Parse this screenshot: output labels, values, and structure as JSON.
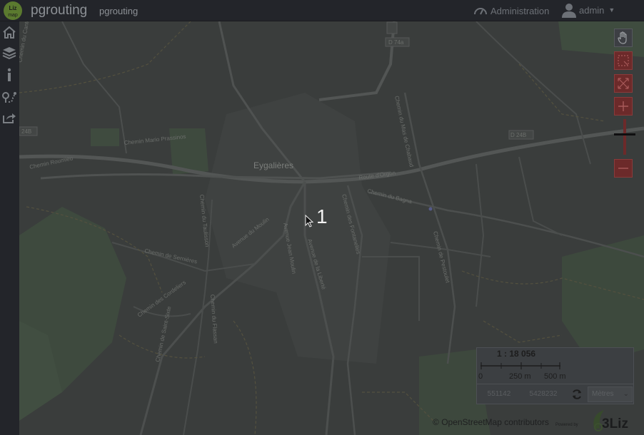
{
  "header": {
    "logo_text": "Liz map",
    "app_title": "pgrouting",
    "project_title": "pgrouting",
    "admin_label": "Administration",
    "user_label": "admin"
  },
  "leftbar": {
    "items": [
      {
        "icon": "home-icon"
      },
      {
        "icon": "layers-icon"
      },
      {
        "icon": "info-icon"
      },
      {
        "icon": "routing-icon"
      },
      {
        "icon": "share-icon"
      }
    ]
  },
  "map": {
    "place_labels": [
      "Eygalières"
    ],
    "road_labels": [
      "D 74a",
      "D 24B",
      "24B",
      "Route d'Orgon",
      "Chemin Mario Prassinos",
      "Chemin Roumieu",
      "Chemin du Bagna",
      "Chemin du Mas de Chabaud",
      "Chemin de Pestoulet",
      "Chemin des Fontanelles",
      "Avenue de la Liberté",
      "Avenue Jean Moulin",
      "Avenue du Moulin",
      "Chemin de Sernières",
      "Chemin des Cordeliers",
      "Chemin du Taulisson",
      "Chemin de Saint-Sixte",
      "Chemin du Flassan",
      "Chemin du Canto",
      "D 24B (east)"
    ],
    "annotation_number": "1"
  },
  "scale": {
    "ratio": "1 : 18 056",
    "ticks": [
      "0",
      "250 m",
      "500 m"
    ],
    "x": "551142",
    "y": "5428232",
    "unit": "Mètres"
  },
  "attribution": {
    "prefix": "© ",
    "link": "OpenStreetMap",
    "suffix": " contributors",
    "powered_by": "Powered by",
    "brand": "3Liz"
  },
  "colors": {
    "header_bg": "#23252a",
    "map_overlay": "#3a3d3c",
    "control_red": "#6c2a2a"
  }
}
